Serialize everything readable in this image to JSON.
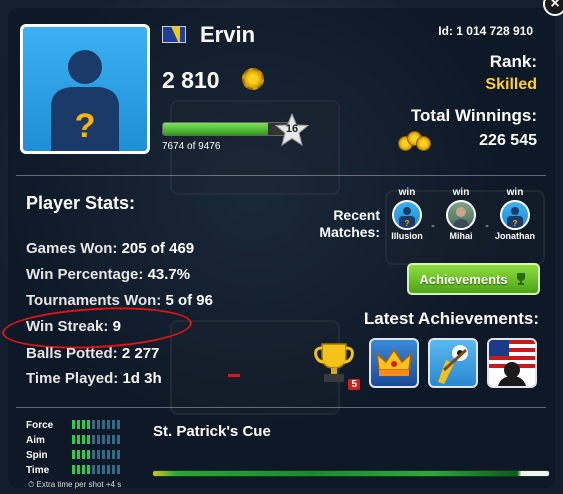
{
  "profile": {
    "name": "Ervin",
    "coins": "2 810",
    "xp_text": "7674 of 9476",
    "xp_fraction": 0.81,
    "level": "16",
    "id_text": "Id: 1 014 728 910",
    "rank_label": "Rank:",
    "rank_value": "Skilled",
    "total_winnings_label": "Total Winnings:",
    "total_winnings_value": "226 545",
    "flag": "bosnia-herzegovina-flag"
  },
  "stats": {
    "title": "Player Stats:",
    "rows": [
      {
        "label": "Games Won:",
        "value": "205 of 469"
      },
      {
        "label": "Win Percentage:",
        "value": "43.7%"
      },
      {
        "label": "Tournaments Won:",
        "value": "5 of 96"
      },
      {
        "label": "Win Streak:",
        "value": "9"
      },
      {
        "label": "Balls Potted:",
        "value": "2 277"
      },
      {
        "label": "Time Played:",
        "value": "1d 3h"
      }
    ]
  },
  "recent": {
    "title_line1": "Recent",
    "title_line2": "Matches:",
    "matches": [
      {
        "result": "win",
        "name": "Illusion"
      },
      {
        "result": "win",
        "name": "Mihai"
      },
      {
        "result": "win",
        "name": "Jonathan"
      }
    ]
  },
  "achievements": {
    "button_label": "Achievements",
    "latest_title": "Latest Achievements:",
    "trophy_count": "5",
    "icons": [
      "trophy-icon",
      "crown-icon",
      "cue-ball-icon",
      "usa-flag-icon"
    ]
  },
  "cue": {
    "name": "St. Patrick's Cue",
    "stats": [
      {
        "label": "Force",
        "level": 4
      },
      {
        "label": "Aim",
        "level": 4
      },
      {
        "label": "Spin",
        "level": 4
      },
      {
        "label": "Time",
        "level": 4
      }
    ],
    "max_level": 10,
    "extra_time": "Extra time per shot +4 s"
  },
  "colors": {
    "rank": "#ffcf2a",
    "button_green": "#6cc52a",
    "streak_highlight": "#e01414"
  }
}
